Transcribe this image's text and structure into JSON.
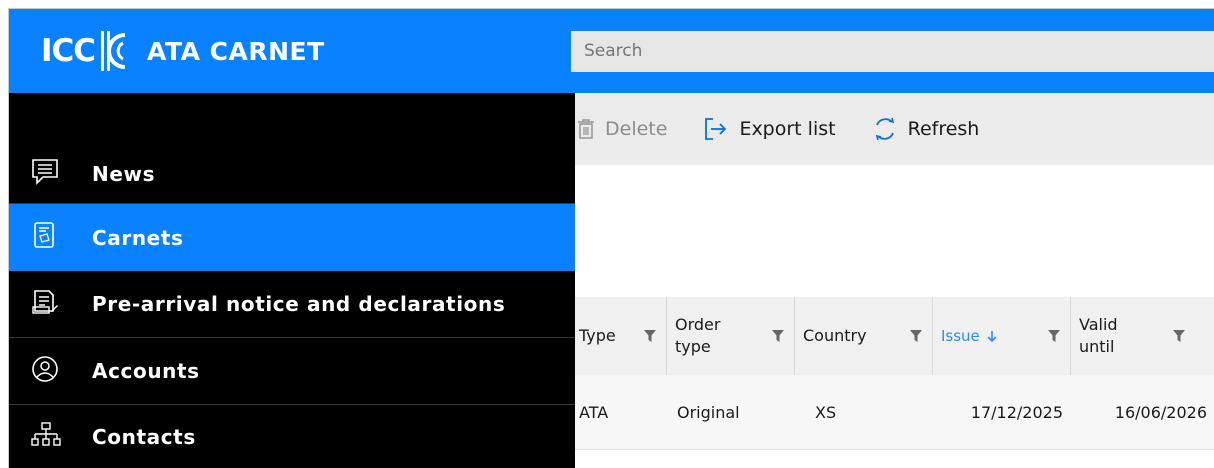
{
  "header": {
    "logo_icc": "ICC",
    "logo_name": "ATA CARNET",
    "search_placeholder": "Search",
    "brand_color": "#0a82ff"
  },
  "toolbar": {
    "delete_label": "Delete",
    "export_label": "Export list",
    "refresh_label": "Refresh"
  },
  "sidebar": {
    "items": [
      {
        "label": "News",
        "icon": "chat-news-icon",
        "active": false
      },
      {
        "label": "Carnets",
        "icon": "carnet-document-icon",
        "active": true
      },
      {
        "label": "Pre-arrival notice and declarations",
        "icon": "declaration-document-icon",
        "active": false
      },
      {
        "label": "Accounts",
        "icon": "user-account-icon",
        "active": false
      },
      {
        "label": "Contacts",
        "icon": "org-chart-icon",
        "active": false
      }
    ]
  },
  "table": {
    "columns": [
      {
        "label": "Type",
        "sorted": false
      },
      {
        "label": "Order type",
        "sorted": false
      },
      {
        "label": "Country",
        "sorted": false
      },
      {
        "label": "Issue",
        "sorted": true,
        "sort_dir": "desc"
      },
      {
        "label": "Valid until",
        "sorted": false
      }
    ],
    "rows": [
      [
        "ATA",
        "Original",
        "XS",
        "17/12/2025",
        "16/06/2026"
      ]
    ]
  }
}
